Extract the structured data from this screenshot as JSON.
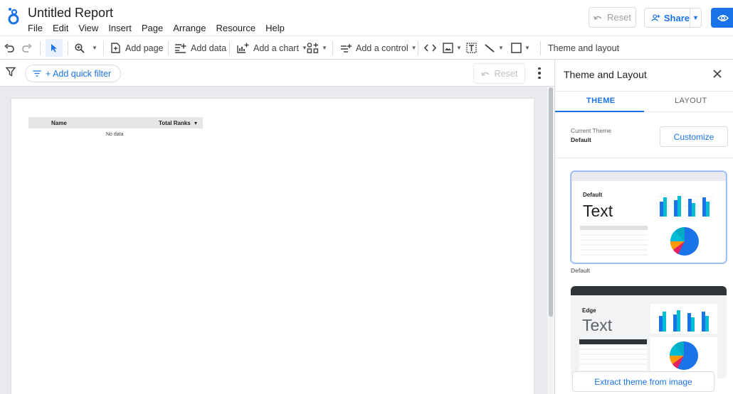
{
  "app": {
    "doc_title": "Untitled Report",
    "menu": [
      "File",
      "Edit",
      "View",
      "Insert",
      "Page",
      "Arrange",
      "Resource",
      "Help"
    ],
    "reset_label": "Reset",
    "share_label": "Share"
  },
  "toolbar": {
    "add_page": "Add page",
    "add_data": "Add data",
    "add_chart": "Add a chart",
    "add_control": "Add a control",
    "theme_layout": "Theme and layout"
  },
  "filterbar": {
    "quick_filter": "+ Add quick filter",
    "reset_label": "Reset"
  },
  "canvas": {
    "table": {
      "columns": [
        "Name",
        "Total Ranks"
      ],
      "sort_indicator": "▾",
      "empty_text": "No data"
    }
  },
  "panel": {
    "title": "Theme and Layout",
    "tabs": [
      "THEME",
      "LAYOUT"
    ],
    "active_tab": "THEME",
    "current_theme_label": "Current Theme",
    "current_theme_value": "Default",
    "customize_label": "Customize",
    "themes": [
      {
        "name": "Default",
        "sample_text": "Text",
        "caption": "Default"
      },
      {
        "name": "Edge",
        "sample_text": "Text"
      }
    ],
    "extract_label": "Extract theme from image"
  },
  "colors": {
    "accent": "#1a73e8",
    "bar_blue": "#1a73e8",
    "bar_cyan": "#00bcd4",
    "pie_blue": "#1a73e8",
    "pie_magenta": "#e91e63",
    "pie_orange": "#ff9800",
    "pie_teal": "#00bcd4",
    "edge_header": "#2e3438"
  }
}
